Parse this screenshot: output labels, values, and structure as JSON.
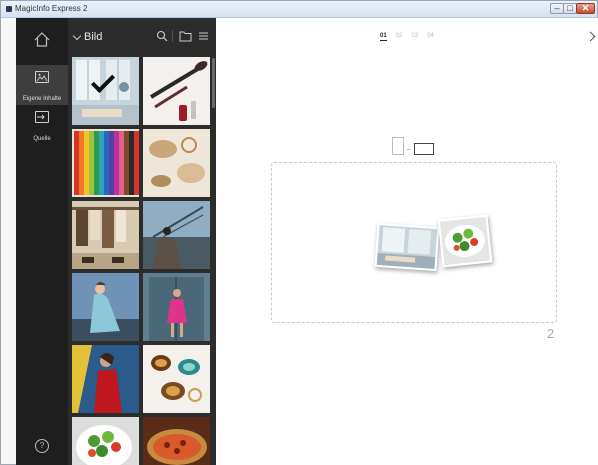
{
  "window": {
    "title": "MagicInfo Express 2"
  },
  "titlebar": {
    "minimize_glyph": "–",
    "maximize_glyph": "□",
    "close_glyph": "✕"
  },
  "nav": {
    "items": [
      {
        "label": "Eigene Inhalte",
        "icon": "image-icon",
        "active": true
      },
      {
        "label": "Quelle",
        "icon": "source-input-icon",
        "active": false
      }
    ],
    "help_glyph": "?"
  },
  "panel": {
    "title": "Bild",
    "icons": [
      "search-icon",
      "folder-icon",
      "list-view-icon"
    ],
    "thumbnails": [
      {
        "subject": "window-interior",
        "selected": true
      },
      {
        "subject": "makeup-brushes",
        "selected": false
      },
      {
        "subject": "colored-pencils",
        "selected": false
      },
      {
        "subject": "accessories",
        "selected": false
      },
      {
        "subject": "clothing-rack",
        "selected": false
      },
      {
        "subject": "woman-bridge",
        "selected": false
      },
      {
        "subject": "woman-blue-dress",
        "selected": false
      },
      {
        "subject": "woman-pink-door",
        "selected": false
      },
      {
        "subject": "woman-red-dress",
        "selected": false
      },
      {
        "subject": "gemstone-rings",
        "selected": false
      },
      {
        "subject": "salad-plate",
        "selected": false
      },
      {
        "subject": "pizza",
        "selected": false
      }
    ]
  },
  "main": {
    "steps": [
      "01",
      "02",
      "03",
      "04"
    ],
    "active_step": "01",
    "orientation": {
      "options": [
        "portrait",
        "landscape"
      ],
      "selected": "landscape"
    },
    "page_number": "2",
    "preview_images": [
      "window-interior",
      "salad-plate"
    ]
  },
  "colors": {
    "nav_bg": "#1e1e1e",
    "panel_bg": "#2c2c2c",
    "active_nav": "#3e3e3e",
    "main_bg": "#ffffff"
  }
}
